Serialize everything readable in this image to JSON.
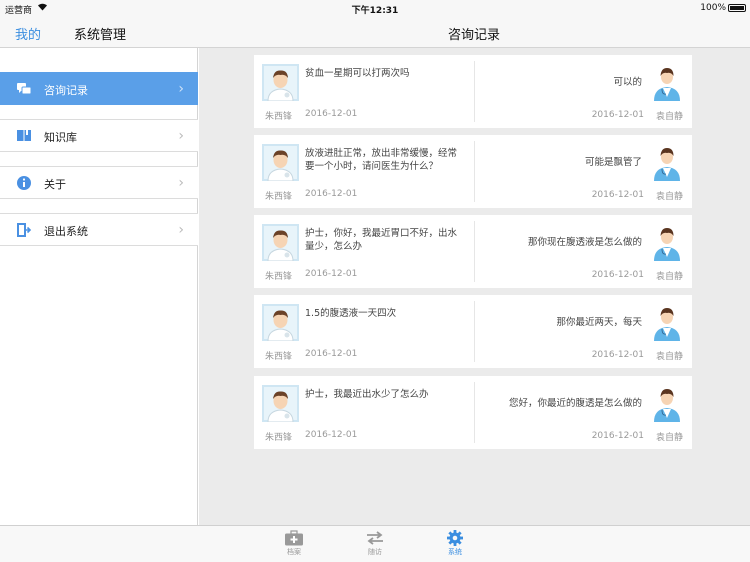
{
  "status_bar": {
    "carrier": "运营商",
    "time": "下午12:31",
    "battery": "100%"
  },
  "nav": {
    "back_label": "我的",
    "section_title": "系统管理",
    "page_title": "咨询记录"
  },
  "sidebar": {
    "items": [
      {
        "label": "咨询记录",
        "icon": "chat-bubbles-icon",
        "active": true
      },
      {
        "label": "知识库",
        "icon": "book-icon",
        "active": false
      },
      {
        "label": "关于",
        "icon": "info-icon",
        "active": false
      },
      {
        "label": "退出系统",
        "icon": "logout-icon",
        "active": false
      }
    ]
  },
  "records": [
    {
      "question": "贫血一星期可以打两次吗",
      "patient": "朱西锋",
      "q_date": "2016-12-01",
      "answer": "可以的",
      "nurse": "袁自静",
      "a_date": "2016-12-01"
    },
    {
      "question": "放液进肚正常，放出非常缓慢，经常要一个小时，请问医生为什么？",
      "patient": "朱西锋",
      "q_date": "2016-12-01",
      "answer": "可能是飘管了",
      "nurse": "袁自静",
      "a_date": "2016-12-01"
    },
    {
      "question": "护士，你好，我最近胃口不好，出水量少，怎么办",
      "patient": "朱西锋",
      "q_date": "2016-12-01",
      "answer": "那你现在腹透液是怎么做的",
      "nurse": "袁自静",
      "a_date": "2016-12-01"
    },
    {
      "question": "1.5的腹透液一天四次",
      "patient": "朱西锋",
      "q_date": "2016-12-01",
      "answer": "那你最近两天，每天",
      "nurse": "袁自静",
      "a_date": "2016-12-01"
    },
    {
      "question": "护士，我最近出水少了怎么办",
      "patient": "朱西锋",
      "q_date": "2016-12-01",
      "answer": "您好，你最近的腹透是怎么做的",
      "nurse": "袁自静",
      "a_date": "2016-12-01"
    }
  ],
  "tabs": [
    {
      "label": "档案",
      "icon": "medical-kit-icon",
      "active": false
    },
    {
      "label": "随访",
      "icon": "swap-arrows-icon",
      "active": false
    },
    {
      "label": "系统",
      "icon": "gear-icon",
      "active": true
    }
  ],
  "colors": {
    "accent": "#3b8ee0",
    "sidebar_active": "#5a9fe8",
    "content_bg": "#ebebeb"
  }
}
